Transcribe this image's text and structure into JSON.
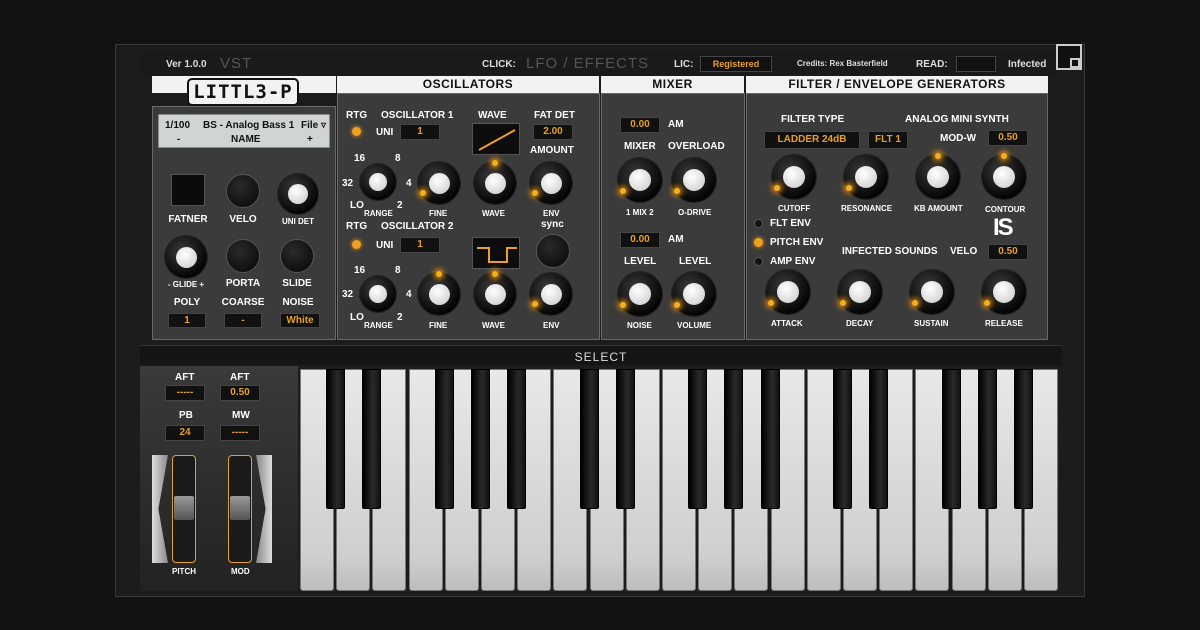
{
  "topbar": {
    "version": "Ver 1.0.0",
    "format": "VST",
    "click_label": "CLICK:",
    "lfo_effects": "LFO / EFFECTS",
    "lic_label": "LIC:",
    "lic_value": "Registered",
    "credits": "Credits: Rex Basterfield",
    "read_label": "READ:",
    "read_value": "",
    "infected": "Infected"
  },
  "logo": "LITTL3-P",
  "headers": {
    "oscillators": "OSCILLATORS",
    "mixer": "MIXER",
    "filter_env": "FILTER / ENVELOPE GENERATORS"
  },
  "preset": {
    "number": "1/100",
    "name": "BS - Analog Bass 1",
    "file": "File ▿",
    "minus": "-",
    "name_label": "NAME",
    "plus": "+"
  },
  "left": {
    "fatner": "FATNER",
    "velo": "VELO",
    "uni_det": "UNI DET",
    "glide": "- GLIDE +",
    "porta": "PORTA",
    "slide": "SLIDE",
    "poly": "POLY",
    "coarse": "COARSE",
    "noise": "NOISE",
    "poly_val": "1",
    "coarse_val": "-",
    "noise_val": "White"
  },
  "osc": {
    "rtg": "RTG",
    "osc1": "OSCILLATOR 1",
    "osc2": "OSCILLATOR 2",
    "uni": "UNI",
    "uni1_val": "1",
    "uni2_val": "1",
    "wave": "WAVE",
    "fat_det": "FAT DET",
    "fat_det_val": "2.00",
    "amount": "AMOUNT",
    "sync": "sync",
    "range": "RANGE",
    "fine": "FINE",
    "env": "ENV",
    "env_sync": "ENV",
    "r16": "16",
    "r8": "8",
    "r32": "32",
    "r4": "4",
    "rlo": "LO",
    "r2": "2"
  },
  "mixer": {
    "am1_val": "0.00",
    "am": "AM",
    "mixer": "MIXER",
    "overload": "OVERLOAD",
    "mix12": "1 MIX 2",
    "odrive": "O-DRIVE",
    "am2_val": "0.00",
    "level": "LEVEL",
    "noise": "NOISE",
    "volume": "VOLUME"
  },
  "filter": {
    "filter_type": "FILTER TYPE",
    "analog_mini": "ANALOG MINI SYNTH",
    "ladder": "LADDER  24dB",
    "flt1": "FLT 1",
    "modw": "MOD-W",
    "modw_val": "0.50",
    "cutoff": "CUTOFF",
    "resonance": "RESONANCE",
    "kb_amount": "KB AMOUNT",
    "contour": "CONTOUR",
    "flt_env": "FLT ENV",
    "pitch_env": "PITCH ENV",
    "amp_env": "AMP ENV",
    "infected_sounds": "INFECTED SOUNDS",
    "velo": "VELO",
    "velo_val": "0.50",
    "attack": "ATTACK",
    "decay": "DECAY",
    "sustain": "SUSTAIN",
    "release": "RELEASE",
    "brand_logo": "IS"
  },
  "select": "SELECT",
  "wheels": {
    "aft1": "AFT",
    "aft1_val": "-----",
    "aft2": "AFT",
    "aft2_val": "0.50",
    "pb": "PB",
    "pb_val": "24",
    "mw": "MW",
    "mw_val": "-----",
    "pitch": "PITCH",
    "mod": "MOD"
  },
  "colors": {
    "accent": "#f0a020",
    "panel": "#3b3b3b",
    "led_text": "#e8a020"
  }
}
